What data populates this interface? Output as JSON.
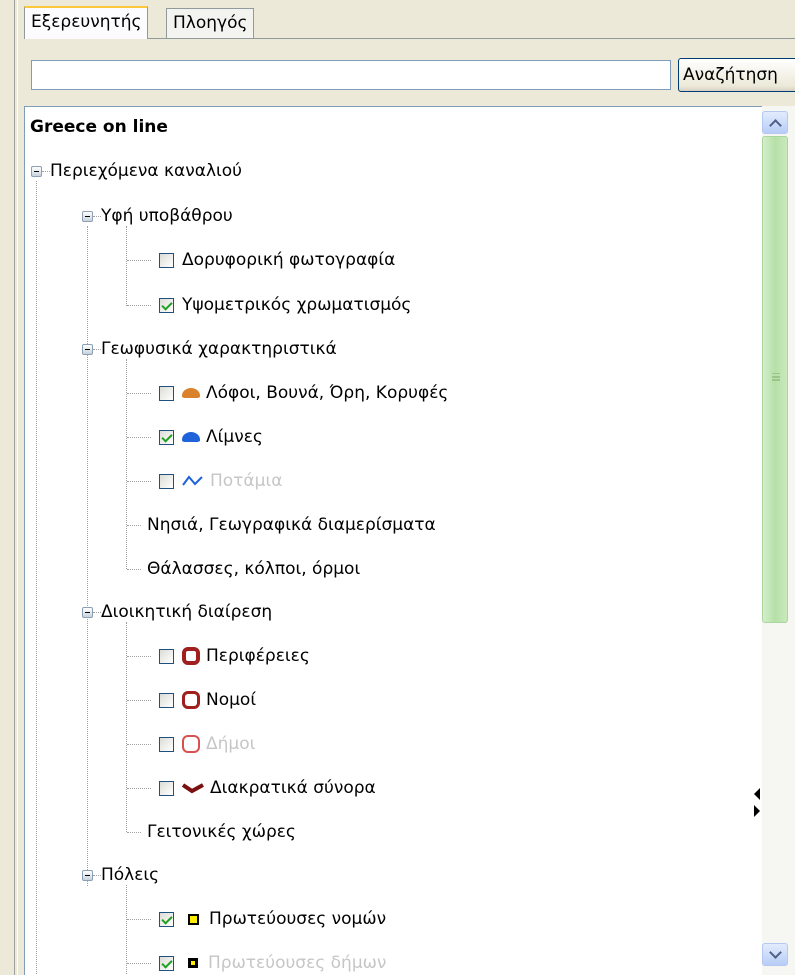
{
  "tabs": [
    {
      "label": "Εξερευνητής",
      "active": true
    },
    {
      "label": "Πλοηγός",
      "active": false
    }
  ],
  "search": {
    "value": "",
    "button_label": "Αναζήτηση"
  },
  "tree": {
    "root": "Greece on line",
    "channel": "Περιεχόμενα καναλιού",
    "groups": {
      "texture": {
        "label": "Υφή υποβάθρου",
        "items": [
          {
            "label": "Δορυφορική φωτογραφία",
            "checked": false
          },
          {
            "label": "Υψομετρικός χρωματισμός",
            "checked": true
          }
        ]
      },
      "geophysical": {
        "label": "Γεωφυσικά χαρακτηριστικά",
        "items": [
          {
            "label": "Λόφοι, Βουνά, Όρη, Κορυφές",
            "checked": false,
            "icon": "mountain-blob-icon",
            "color": "#d9822b"
          },
          {
            "label": "Λίμνες",
            "checked": true,
            "icon": "lake-blob-icon",
            "color": "#1e63d9"
          },
          {
            "label": "Ποτάμια",
            "checked": false,
            "icon": "river-line-icon",
            "color": "#1e63d9",
            "disabled": true
          },
          {
            "label": "Νησιά, Γεωγραφικά διαμερίσματα"
          },
          {
            "label": "Θάλασσες, κόλποι, όρμοι"
          }
        ]
      },
      "administrative": {
        "label": "Διοικητική διαίρεση",
        "items": [
          {
            "label": "Περιφέρειες",
            "checked": false,
            "icon": "region-octagon-icon",
            "color": "#a02020"
          },
          {
            "label": "Νομοί",
            "checked": false,
            "icon": "prefecture-octagon-icon",
            "color": "#a02020"
          },
          {
            "label": "Δήμοι",
            "checked": false,
            "icon": "municipality-octagon-icon",
            "color": "#d85050",
            "disabled": true
          },
          {
            "label": "Διακρατικά σύνορα",
            "checked": false,
            "icon": "border-line-icon",
            "color": "#7a1010"
          },
          {
            "label": "Γειτονικές χώρες"
          }
        ]
      },
      "cities": {
        "label": "Πόλεις",
        "items": [
          {
            "label": "Πρωτεύουσες νομών",
            "checked": true,
            "icon": "prefecture-capital-square-icon",
            "color": "#ffee00"
          },
          {
            "label": "Πρωτεύουσες δήμων",
            "checked": true,
            "icon": "municipal-capital-square-icon",
            "color": "#ffee00",
            "disabled": true
          }
        ]
      }
    }
  }
}
